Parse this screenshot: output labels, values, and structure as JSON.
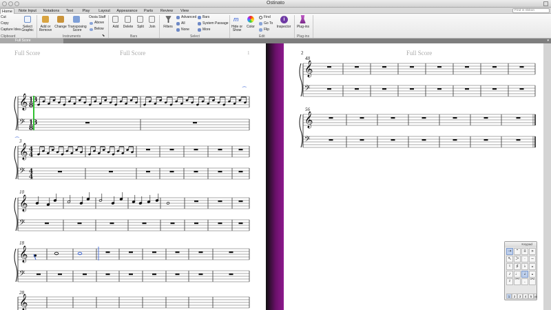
{
  "window": {
    "title": "Ostinato"
  },
  "tabs": [
    {
      "label": "Home",
      "active": true
    },
    {
      "label": "Note Input"
    },
    {
      "label": "Notations"
    },
    {
      "label": "Text"
    },
    {
      "label": "Play"
    },
    {
      "label": "Layout"
    },
    {
      "label": "Appearance"
    },
    {
      "label": "Parts"
    },
    {
      "label": "Review"
    },
    {
      "label": "View"
    }
  ],
  "search": {
    "placeholder": "Find in ribbon"
  },
  "ribbon": {
    "clipboard": {
      "cut": "Cut",
      "copy": "Copy",
      "capture_idea": "Capture Idea",
      "select_graphic_1": "Select",
      "select_graphic_2": "Graphic",
      "group": "Clipboard"
    },
    "instruments": {
      "add_remove_1": "Add or",
      "add_remove_2": "Remove",
      "change": "Change",
      "transposing_1": "Transposing",
      "transposing_2": "Score",
      "ossia_staff": "Ossia Staff",
      "above": "Above",
      "below": "Below",
      "group": "Instruments"
    },
    "bars": {
      "add": "Add",
      "delete": "Delete",
      "split": "Split",
      "join": "Join",
      "group": "Bars"
    },
    "select": {
      "filters": "Filters",
      "advanced": "Advanced",
      "all": "All",
      "none": "None",
      "bars": "Bars",
      "system_passage": "System Passage",
      "more": "More",
      "group": "Select"
    },
    "edit": {
      "hide_show_1": "Hide or",
      "hide_show_2": "Show",
      "color": "Color",
      "find": "Find",
      "go_to": "Go To",
      "flip": "Flip",
      "inspector": "Inspector",
      "group": "Edit"
    },
    "plugins": {
      "plugins": "Plug-ins",
      "group": "Plug-ins"
    }
  },
  "document_tab": {
    "label": "Full Score"
  },
  "score": {
    "left_header": "Full Score",
    "left_header_center": "Full Score",
    "left_page_number": "1",
    "right_header": "Full Score",
    "right_page_number": "2",
    "bar_numbers": {
      "sys2": "3",
      "sys3": "10",
      "sys4": "18",
      "sys5": "28",
      "r_sys1": "48",
      "r_sys2": "56"
    },
    "time_sig_top": "13",
    "time_sig_bottom": "8",
    "time_sig_44_top": "4",
    "time_sig_44_bottom": "4"
  },
  "keypad": {
    "title": "Keypad",
    "row1": [
      "⇢",
      "⌃",
      "≡",
      "»"
    ],
    "row2": [
      "↖",
      "＞",
      "·",
      "–"
    ],
    "row3": [
      "♮",
      "♯",
      "♭",
      "𝄪"
    ],
    "row4": [
      "♪",
      "♩",
      "𝅗𝅥",
      "𝅝"
    ],
    "row5": [
      "𝄽",
      "⁀",
      ".",
      "⌒"
    ],
    "tabs": [
      "1",
      "2",
      "3",
      "4",
      "5",
      "All"
    ]
  },
  "colors": {
    "accent": "#2a57d3",
    "gap_magenta": "#8e1a8e",
    "selection_green": "#2fbf2f"
  }
}
